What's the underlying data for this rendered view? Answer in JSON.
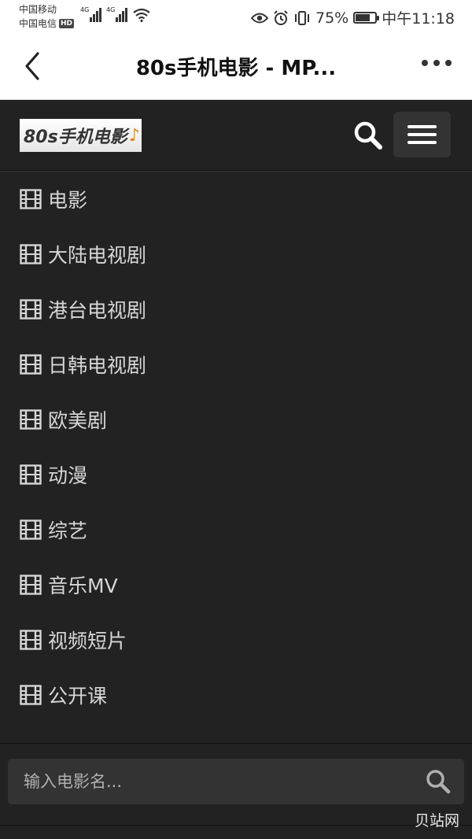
{
  "status_bar": {
    "carrier_1": "中国移动",
    "carrier_2": "中国电信",
    "hd_badge": "HD",
    "signal_1_label": "4G",
    "signal_2_label": "4G",
    "battery_percent": "75%",
    "battery_level": 0.75,
    "time": "中午11:18"
  },
  "app_header": {
    "title": "80s手机电影 - MP..."
  },
  "site_nav": {
    "logo_text": "80s手机电影",
    "logo_note": "♪"
  },
  "menu": {
    "items": [
      {
        "label": "电影"
      },
      {
        "label": "大陆电视剧"
      },
      {
        "label": "港台电视剧"
      },
      {
        "label": "日韩电视剧"
      },
      {
        "label": "欧美剧"
      },
      {
        "label": "动漫"
      },
      {
        "label": "综艺"
      },
      {
        "label": "音乐MV"
      },
      {
        "label": "视频短片"
      },
      {
        "label": "公开课"
      }
    ]
  },
  "search": {
    "placeholder": "输入电影名...",
    "value": ""
  },
  "watermark": "贝站网",
  "colors": {
    "page_bg": "#222222",
    "menu_text": "#d6d6d6",
    "search_box": "#333333",
    "logo_note": "#e08a1e"
  }
}
